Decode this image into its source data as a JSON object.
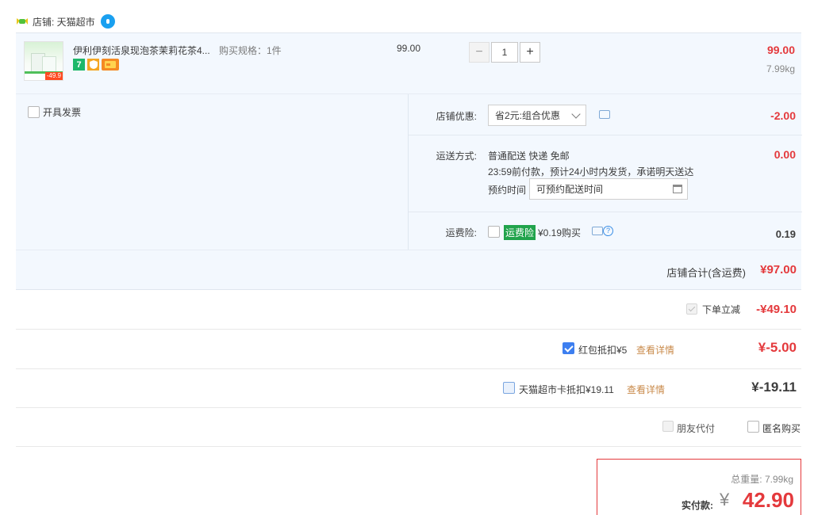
{
  "shop": {
    "name": "店铺: 天猫超市",
    "logo_icon": "tmall-cat-icon",
    "chat_icon": "wangwang-icon"
  },
  "product": {
    "title": "伊利伊刻活泉现泡茶茉莉花茶4...",
    "spec": "购买规格：1件",
    "price": "99.00",
    "quantity": "1",
    "minus": "−",
    "plus": "+",
    "subtotal": "99.00",
    "weight": "7.99kg",
    "thumb_tag": "-49.9",
    "badge_7": "7"
  },
  "options": {
    "invoice_label": "开具发票",
    "store_discount": {
      "label": "店铺优惠:",
      "selected": "省2元:组合优惠",
      "amount": "-2.00"
    },
    "shipping": {
      "label": "运送方式:",
      "method": "普通配送 快递 免邮",
      "note": "23:59前付款，预计24小时内发货，承诺明天送达",
      "schedule_label": "预约时间",
      "schedule_placeholder": "可预约配送时间",
      "amount": "0.00"
    },
    "insurance": {
      "label": "运费险:",
      "tag": "运费险",
      "price": "¥0.19购买",
      "amount": "0.19"
    }
  },
  "store_total": {
    "label": "店铺合计(含运费)",
    "amount": "¥97.00"
  },
  "instant_discount": {
    "label": "下单立减",
    "amount": "-¥49.10"
  },
  "red_packet": {
    "label": "红包抵扣¥5",
    "link": "查看详情",
    "amount": "¥-5.00"
  },
  "tmall_card": {
    "label": "天猫超市卡抵扣¥19.11",
    "link": "查看详情",
    "amount": "¥-19.11"
  },
  "extras": {
    "friend_pay": "朋友代付",
    "anonymous": "匿名购买"
  },
  "payment": {
    "weight": "总重量: 7.99kg",
    "label": "实付款:",
    "yen": "¥",
    "amount": "42.90"
  },
  "colors": {
    "accent_red": "#e4393c",
    "panel_bg": "#f3f8fe",
    "checkbox_blue": "#3d7ff0",
    "link_brown": "#c98a4a"
  }
}
